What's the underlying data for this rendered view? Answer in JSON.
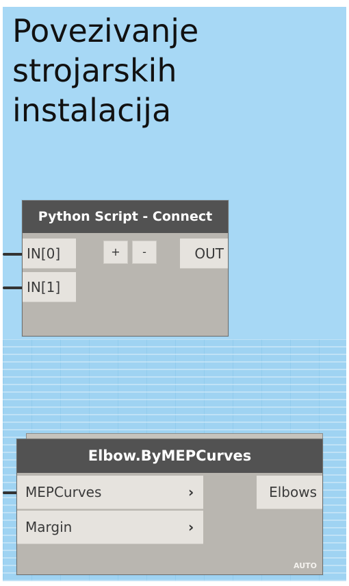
{
  "title": "Povezivanje strojarskih instalacija",
  "python_node": {
    "header": "Python Script - Connect",
    "inputs": [
      "IN[0]",
      "IN[1]"
    ],
    "add_label": "+",
    "remove_label": "-",
    "output": "OUT"
  },
  "elbow_node": {
    "header": "Elbow.ByMEPCurves",
    "inputs": [
      "MEPCurves",
      "Margin"
    ],
    "chevron": "›",
    "output": "Elbows",
    "lacing": "AUTO"
  },
  "colors": {
    "canvas": "#a7d8f5",
    "node_header": "#525252",
    "node_body": "#b9b6b0",
    "port": "#e6e3de"
  }
}
